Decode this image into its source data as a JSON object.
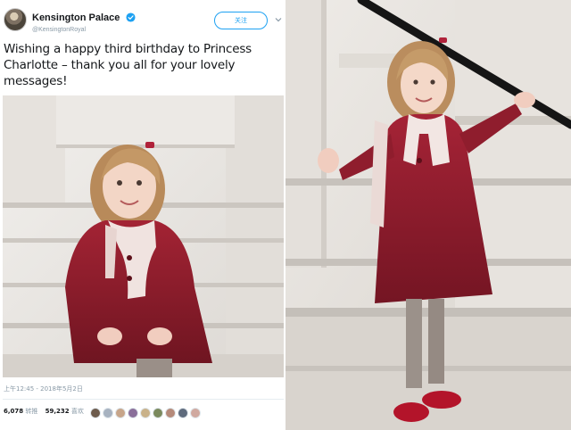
{
  "tweet": {
    "display_name": "Kensington Palace",
    "handle": "@KensingtonRoyal",
    "follow_label": "关注",
    "text": "Wishing a happy third birthday to Princess Charlotte – thank you all for your lovely messages!",
    "timestamp": "上午12:45 - 2018年5月2日",
    "retweets_count": "6,078",
    "retweets_label": "转推",
    "likes_count": "59,232",
    "likes_label": "喜欢",
    "liker_colors": [
      "#6d5b4c",
      "#a7b2c0",
      "#c7a58a",
      "#8a6f9a",
      "#c9b28a",
      "#7b8a5e",
      "#b58a7a",
      "#5f6b7d",
      "#d0a9a0"
    ]
  },
  "colors": {
    "accent": "#1da1f2",
    "coat": "#8e1c2a",
    "scarf": "#f1e4e1",
    "steps": "#dedad5"
  }
}
